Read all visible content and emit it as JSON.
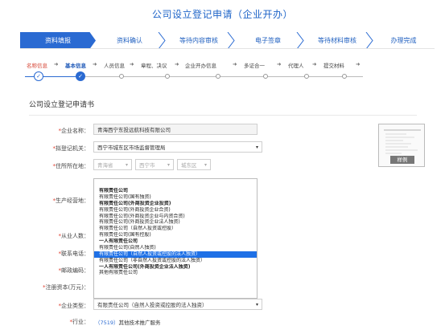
{
  "title": "公司设立登记申请（企业开办）",
  "steps": [
    "资料填报",
    "资料确认",
    "等待内容审核",
    "电子签章",
    "等待材料审核",
    "办理完成"
  ],
  "substeps": [
    "名称信息",
    "基本信息",
    "人员信息",
    "章程、决议",
    "企业开办信息",
    "多证合一",
    "代理人",
    "提交材料"
  ],
  "section_title": "公司设立登记申请书",
  "form": {
    "company_name_label": "企业名称：",
    "company_name": "青海西宁东投远航科技有限公司",
    "authority_label": "拟登记机关：",
    "authority": "西宁市城东区市场监督管理局",
    "address_label": "住所所在地：",
    "province": "青海省",
    "city": "西宁市",
    "district": "城东区",
    "business_label": "生产经营地：",
    "employees_label": "从业人数：",
    "phone_label": "联系电话：",
    "postcode_label": "邮政编码：",
    "capital_label": "注册资本(万元)：",
    "type_label": "企业类型：",
    "type_value": "有限责任公司（自然人投资或控股的法人独资）",
    "industry_label": "行业：",
    "industry_code": "（7519）",
    "industry_value": "其他技术推广服务"
  },
  "type_options": [
    {
      "text": "有限责任公司",
      "bold": true
    },
    {
      "text": "有限责任公司(国有独资)",
      "bold": false
    },
    {
      "text": "有限责任公司(外商投资企业投资)",
      "bold": true
    },
    {
      "text": "有限责任公司(外商投资企业合资)",
      "bold": false
    },
    {
      "text": "有限责任公司(外商投资企业与内资合资)",
      "bold": false
    },
    {
      "text": "有限责任公司(外商投资企业法人独资)",
      "bold": false
    },
    {
      "text": "有限责任公司（自然人投资或控股）",
      "bold": false
    },
    {
      "text": "有限责任公司(国有控股)",
      "bold": false
    },
    {
      "text": "一人有限责任公司",
      "bold": true
    },
    {
      "text": "有限责任公司(自然人独资)",
      "bold": false
    },
    {
      "text": "有限责任公司（自然人投资或控股的法人独资）",
      "bold": false,
      "selected": true
    },
    {
      "text": "有限责任公司（非自然人投资或控股的法人独资）",
      "bold": false
    },
    {
      "text": "一人有限责任公司(外商投资企业法人独资)",
      "bold": true
    },
    {
      "text": "其他有限责任公司",
      "bold": false
    }
  ],
  "sample_label": "样例",
  "colors": {
    "accent": "#2a6ad2",
    "required": "#e03c2c",
    "selected": "#1e70e6"
  }
}
